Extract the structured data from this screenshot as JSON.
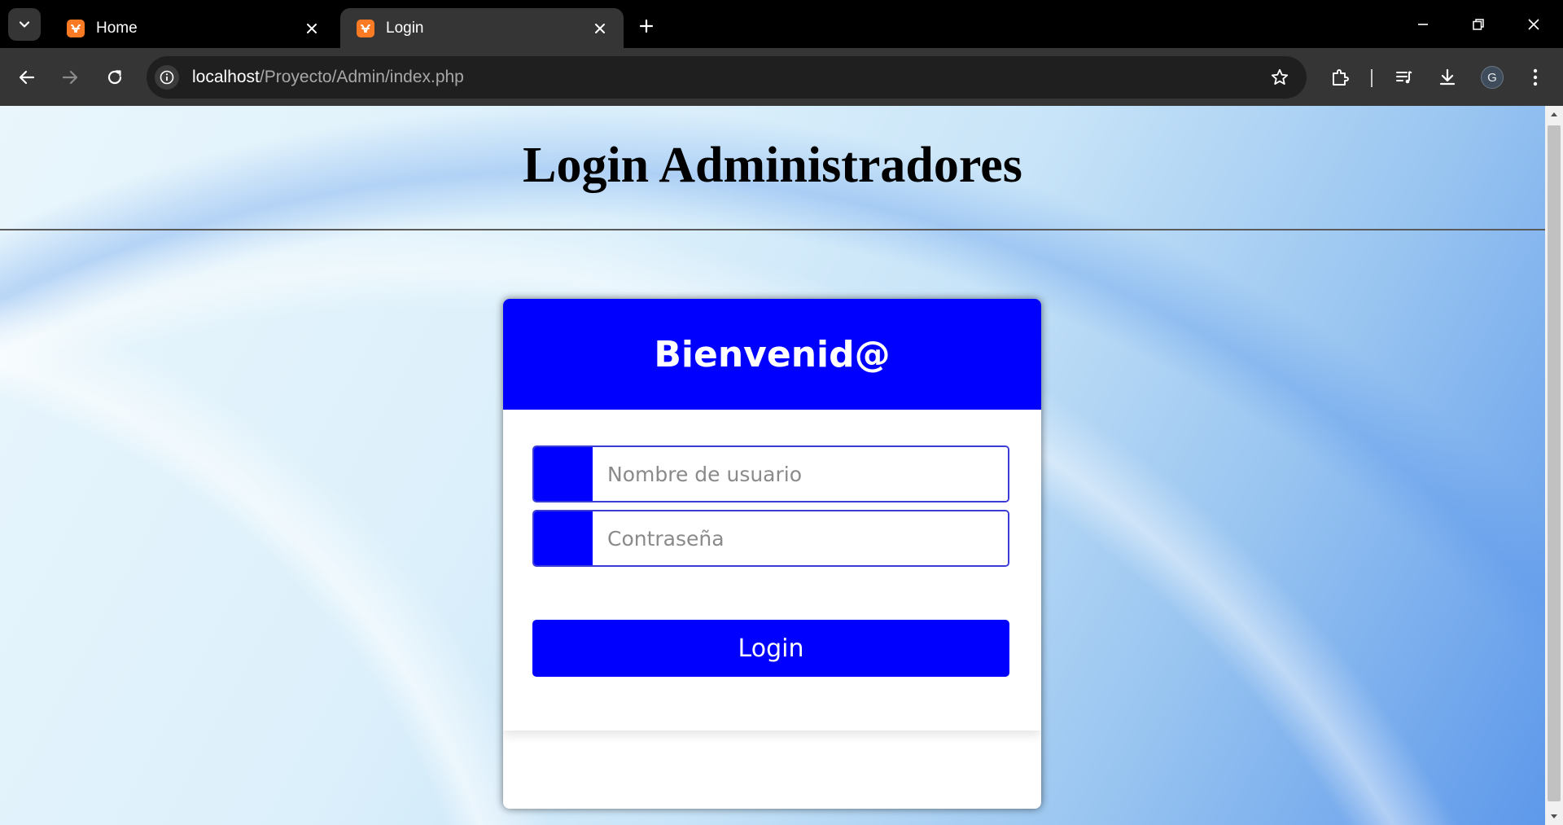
{
  "browser": {
    "tabs": [
      {
        "title": "Home",
        "active": false,
        "favicon": "xampp-icon"
      },
      {
        "title": "Login",
        "active": true,
        "favicon": "xampp-icon"
      }
    ],
    "address": {
      "host": "localhost",
      "path": "/Proyecto/Admin/index.php"
    },
    "profile_initial": "G"
  },
  "page": {
    "title": "Login Administradores",
    "card": {
      "heading": "Bienvenid@",
      "username_placeholder": "Nombre de usuario",
      "password_placeholder": "Contraseña",
      "button_label": "Login"
    }
  },
  "colors": {
    "accent": "#0000ff",
    "browser_frame": "#353535",
    "favicon": "#fb7a24"
  }
}
